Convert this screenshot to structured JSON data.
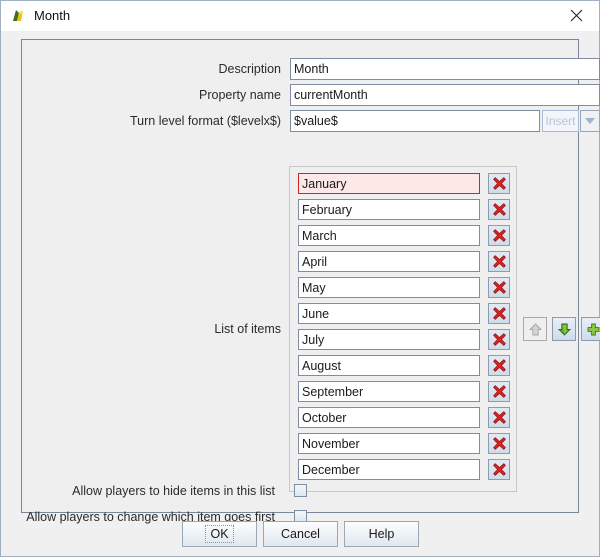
{
  "window": {
    "title": "Month",
    "icon": "vassal-logo-icon",
    "close_label": "✕"
  },
  "form": {
    "description": {
      "label": "Description",
      "value": "Month"
    },
    "property_name": {
      "label": "Property name",
      "value": "currentMonth"
    },
    "turn_level_format": {
      "label": "Turn level format ($levelx$)",
      "value": "$value$",
      "insert_label": "Insert",
      "insert_enabled": false
    }
  },
  "list": {
    "label": "List of items",
    "selected_index": 0,
    "delete_icon": "red-x-delete-icon",
    "items": [
      "January",
      "February",
      "March",
      "April",
      "May",
      "June",
      "July",
      "August",
      "September",
      "October",
      "November",
      "December"
    ]
  },
  "list_controls": {
    "move_up": {
      "icon": "up-arrow-icon",
      "enabled": false
    },
    "move_down": {
      "icon": "down-arrow-icon",
      "enabled": true
    },
    "add": {
      "icon": "plus-icon",
      "enabled": true
    }
  },
  "options": {
    "hide_items": {
      "label": "Allow players to hide items in this list",
      "checked": false
    },
    "change_first": {
      "label": "Allow players to change which item goes first",
      "checked": false
    }
  },
  "buttons": {
    "ok": "OK",
    "cancel": "Cancel",
    "help": "Help"
  },
  "colors": {
    "selection_border": "#d82020",
    "selection_fill": "#fde8e8",
    "delete_icon": "#dd2222",
    "enabled_arrow": "#5ea82e",
    "disabled_arrow": "#c9c9c9",
    "window_bg": "#f0f0f0"
  }
}
